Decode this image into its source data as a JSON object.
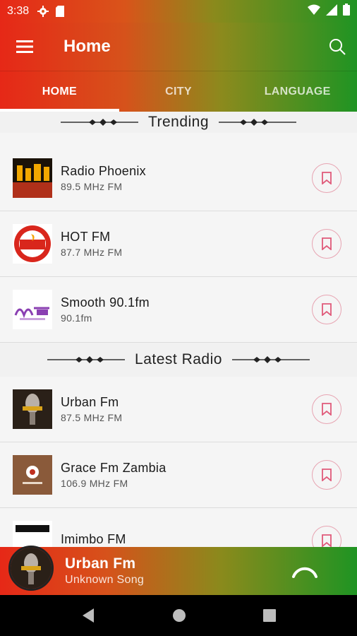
{
  "status": {
    "time": "3:38"
  },
  "header": {
    "title": "Home"
  },
  "tabs": [
    {
      "label": "HOME"
    },
    {
      "label": "CITY"
    },
    {
      "label": "LANGUAGE"
    }
  ],
  "sections": {
    "trending": {
      "title": "Trending",
      "items": [
        {
          "name": "Radio Phoenix",
          "freq": "89.5 MHz FM"
        },
        {
          "name": "HOT FM",
          "freq": "87.7 MHz FM"
        },
        {
          "name": "Smooth 90.1fm",
          "freq": "90.1fm"
        }
      ]
    },
    "latest": {
      "title": "Latest Radio",
      "items": [
        {
          "name": "Urban Fm",
          "freq": "87.5 MHz FM"
        },
        {
          "name": "Grace Fm Zambia",
          "freq": "106.9 MHz FM"
        },
        {
          "name": "Imimbo FM",
          "freq": ""
        }
      ]
    }
  },
  "player": {
    "title": "Urban Fm",
    "subtitle": "Unknown Song"
  },
  "colors": {
    "red": "#e62817",
    "green": "#1f9423",
    "bookmark": "#e05a7a"
  }
}
